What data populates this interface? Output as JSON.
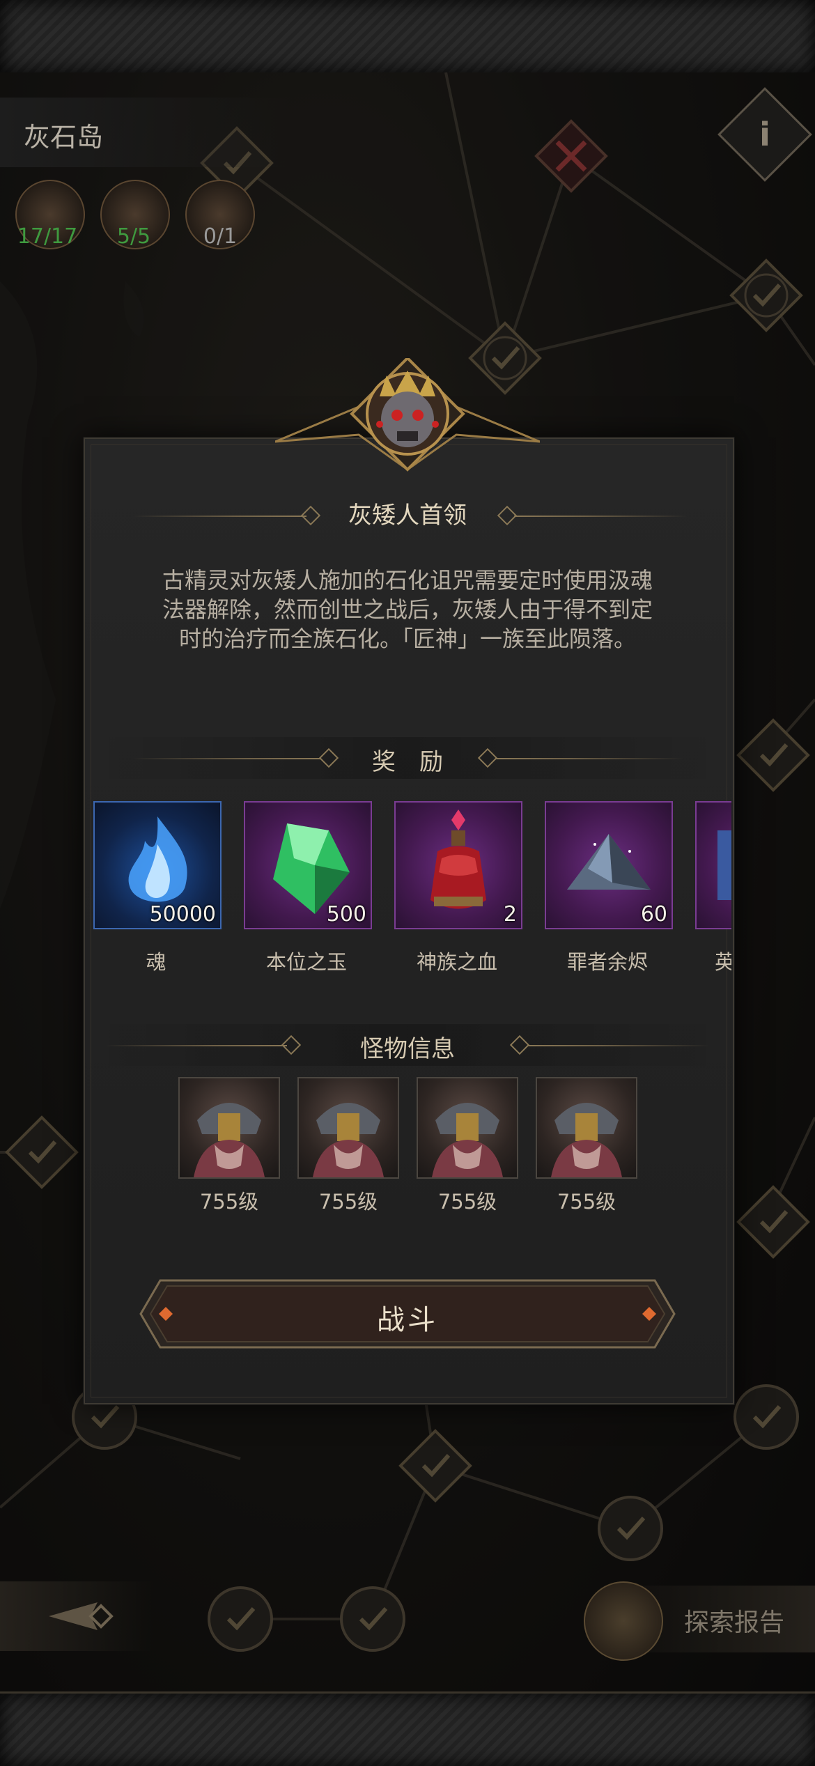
{
  "region": {
    "name": "灰石岛",
    "info_icon": "info-icon"
  },
  "chests": [
    {
      "icon": "silver-chest-icon",
      "count": "17/17",
      "color": "#3f9a3f"
    },
    {
      "icon": "red-chest-icon",
      "count": "5/5",
      "color": "#3f9a3f"
    },
    {
      "icon": "boss-chest-icon",
      "count": "0/1",
      "color": "#9a9a9a"
    }
  ],
  "dialog": {
    "title": "灰矮人首领",
    "description": "古精灵对灰矮人施加的石化诅咒需要定时使用汲魂法器解除，然而创世之战后，灰矮人由于得不到定时的治疗而全族石化。「匠神」一族至此陨落。",
    "rewards_title": "奖　励",
    "rewards": [
      {
        "name": "魂",
        "count": "50000",
        "icon": "soul-flame-icon",
        "rarity": "blue"
      },
      {
        "name": "本位之玉",
        "count": "500",
        "icon": "green-gem-icon",
        "rarity": "purple"
      },
      {
        "name": "神族之血",
        "count": "2",
        "icon": "blood-potion-icon",
        "rarity": "purple"
      },
      {
        "name": "罪者余烬",
        "count": "60",
        "icon": "ember-crystal-icon",
        "rarity": "purple"
      },
      {
        "name": "英",
        "count": "",
        "icon": "item-icon",
        "rarity": "purple"
      }
    ],
    "monsters_title": "怪物信息",
    "monsters": [
      {
        "level": "755级"
      },
      {
        "level": "755级"
      },
      {
        "level": "755级"
      },
      {
        "level": "755级"
      }
    ],
    "fight_label": "战斗"
  },
  "bottom": {
    "report_label": "探索报告"
  },
  "colors": {
    "gold": "#8a7856",
    "panel": "#242424",
    "progress_green": "#3f9a3f"
  }
}
